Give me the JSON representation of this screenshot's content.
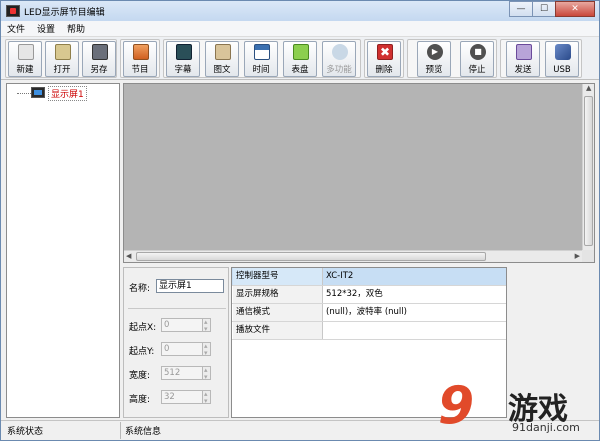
{
  "window": {
    "title": "LED显示屏节目编辑",
    "min_label": "—",
    "max_label": "☐",
    "close_label": "✕"
  },
  "menu": [
    "文件",
    "设置",
    "帮助"
  ],
  "toolbar": {
    "buttons": [
      {
        "label": "新建",
        "icon": "new-file-icon",
        "color": "#e0e0e0",
        "enabled": true
      },
      {
        "label": "打开",
        "icon": "open-folder-icon",
        "color": "#d8c890",
        "enabled": true
      },
      {
        "label": "另存",
        "icon": "save-disk-icon",
        "color": "#6a6f7a",
        "enabled": true
      },
      {
        "label": "节目",
        "icon": "program-icon",
        "color": "#e07030",
        "enabled": true
      },
      {
        "label": "字幕",
        "icon": "subtitle-icon",
        "color": "#2a4f58",
        "enabled": true
      },
      {
        "label": "图文",
        "icon": "picture-text-icon",
        "color": "#c9b38a",
        "enabled": true
      },
      {
        "label": "时间",
        "icon": "calendar-icon",
        "color": "#3a6fb0",
        "enabled": true
      },
      {
        "label": "表盘",
        "icon": "clock-icon",
        "color": "#6fae3a",
        "enabled": true
      },
      {
        "label": "多功能",
        "icon": "multi-function-icon",
        "color": "#b9c9d9",
        "enabled": false
      },
      {
        "label": "删除",
        "icon": "delete-icon",
        "color": "#d03030",
        "enabled": true
      },
      {
        "label": "预览",
        "icon": "play-icon",
        "color": "#505050",
        "enabled": true
      },
      {
        "label": "停止",
        "icon": "stop-icon",
        "color": "#505050",
        "enabled": true
      },
      {
        "label": "发送",
        "icon": "send-icon",
        "color": "#8060b0",
        "enabled": true
      },
      {
        "label": "USB",
        "icon": "usb-icon",
        "color": "#3a5a9a",
        "enabled": true
      }
    ]
  },
  "tree": {
    "root_label": "显示屏1"
  },
  "props": {
    "name_label": "名称:",
    "name_value": "显示屏1",
    "x_label": "起点X:",
    "x_value": "0",
    "y_label": "起点Y:",
    "y_value": "0",
    "width_label": "宽度:",
    "width_value": "512",
    "height_label": "高度:",
    "height_value": "32"
  },
  "info": {
    "rows": [
      {
        "key": "控制器型号",
        "value": "XC-IT2"
      },
      {
        "key": "显示屏规格",
        "value": "512*32，双色"
      },
      {
        "key": "通信模式",
        "value": "(null)，波特率 (null)"
      },
      {
        "key": "播放文件",
        "value": ""
      }
    ]
  },
  "status": {
    "left": "系统状态",
    "right": "系统信息"
  },
  "watermark": {
    "logo": "9",
    "text": "游戏",
    "domain": "91danji.com"
  }
}
